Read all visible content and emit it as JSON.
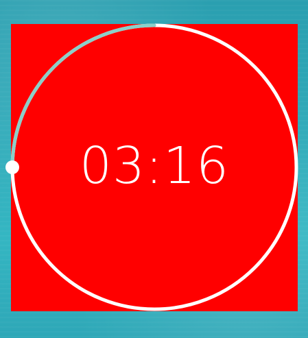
{
  "timer": {
    "time_text": "03:16",
    "progress_fraction": 0.25,
    "colors": {
      "panel": "#ff0000",
      "ring_track": "#ffffff",
      "ring_progress": "#8ccfc8",
      "knob": "#ffffff",
      "text": "#ffffff"
    }
  }
}
